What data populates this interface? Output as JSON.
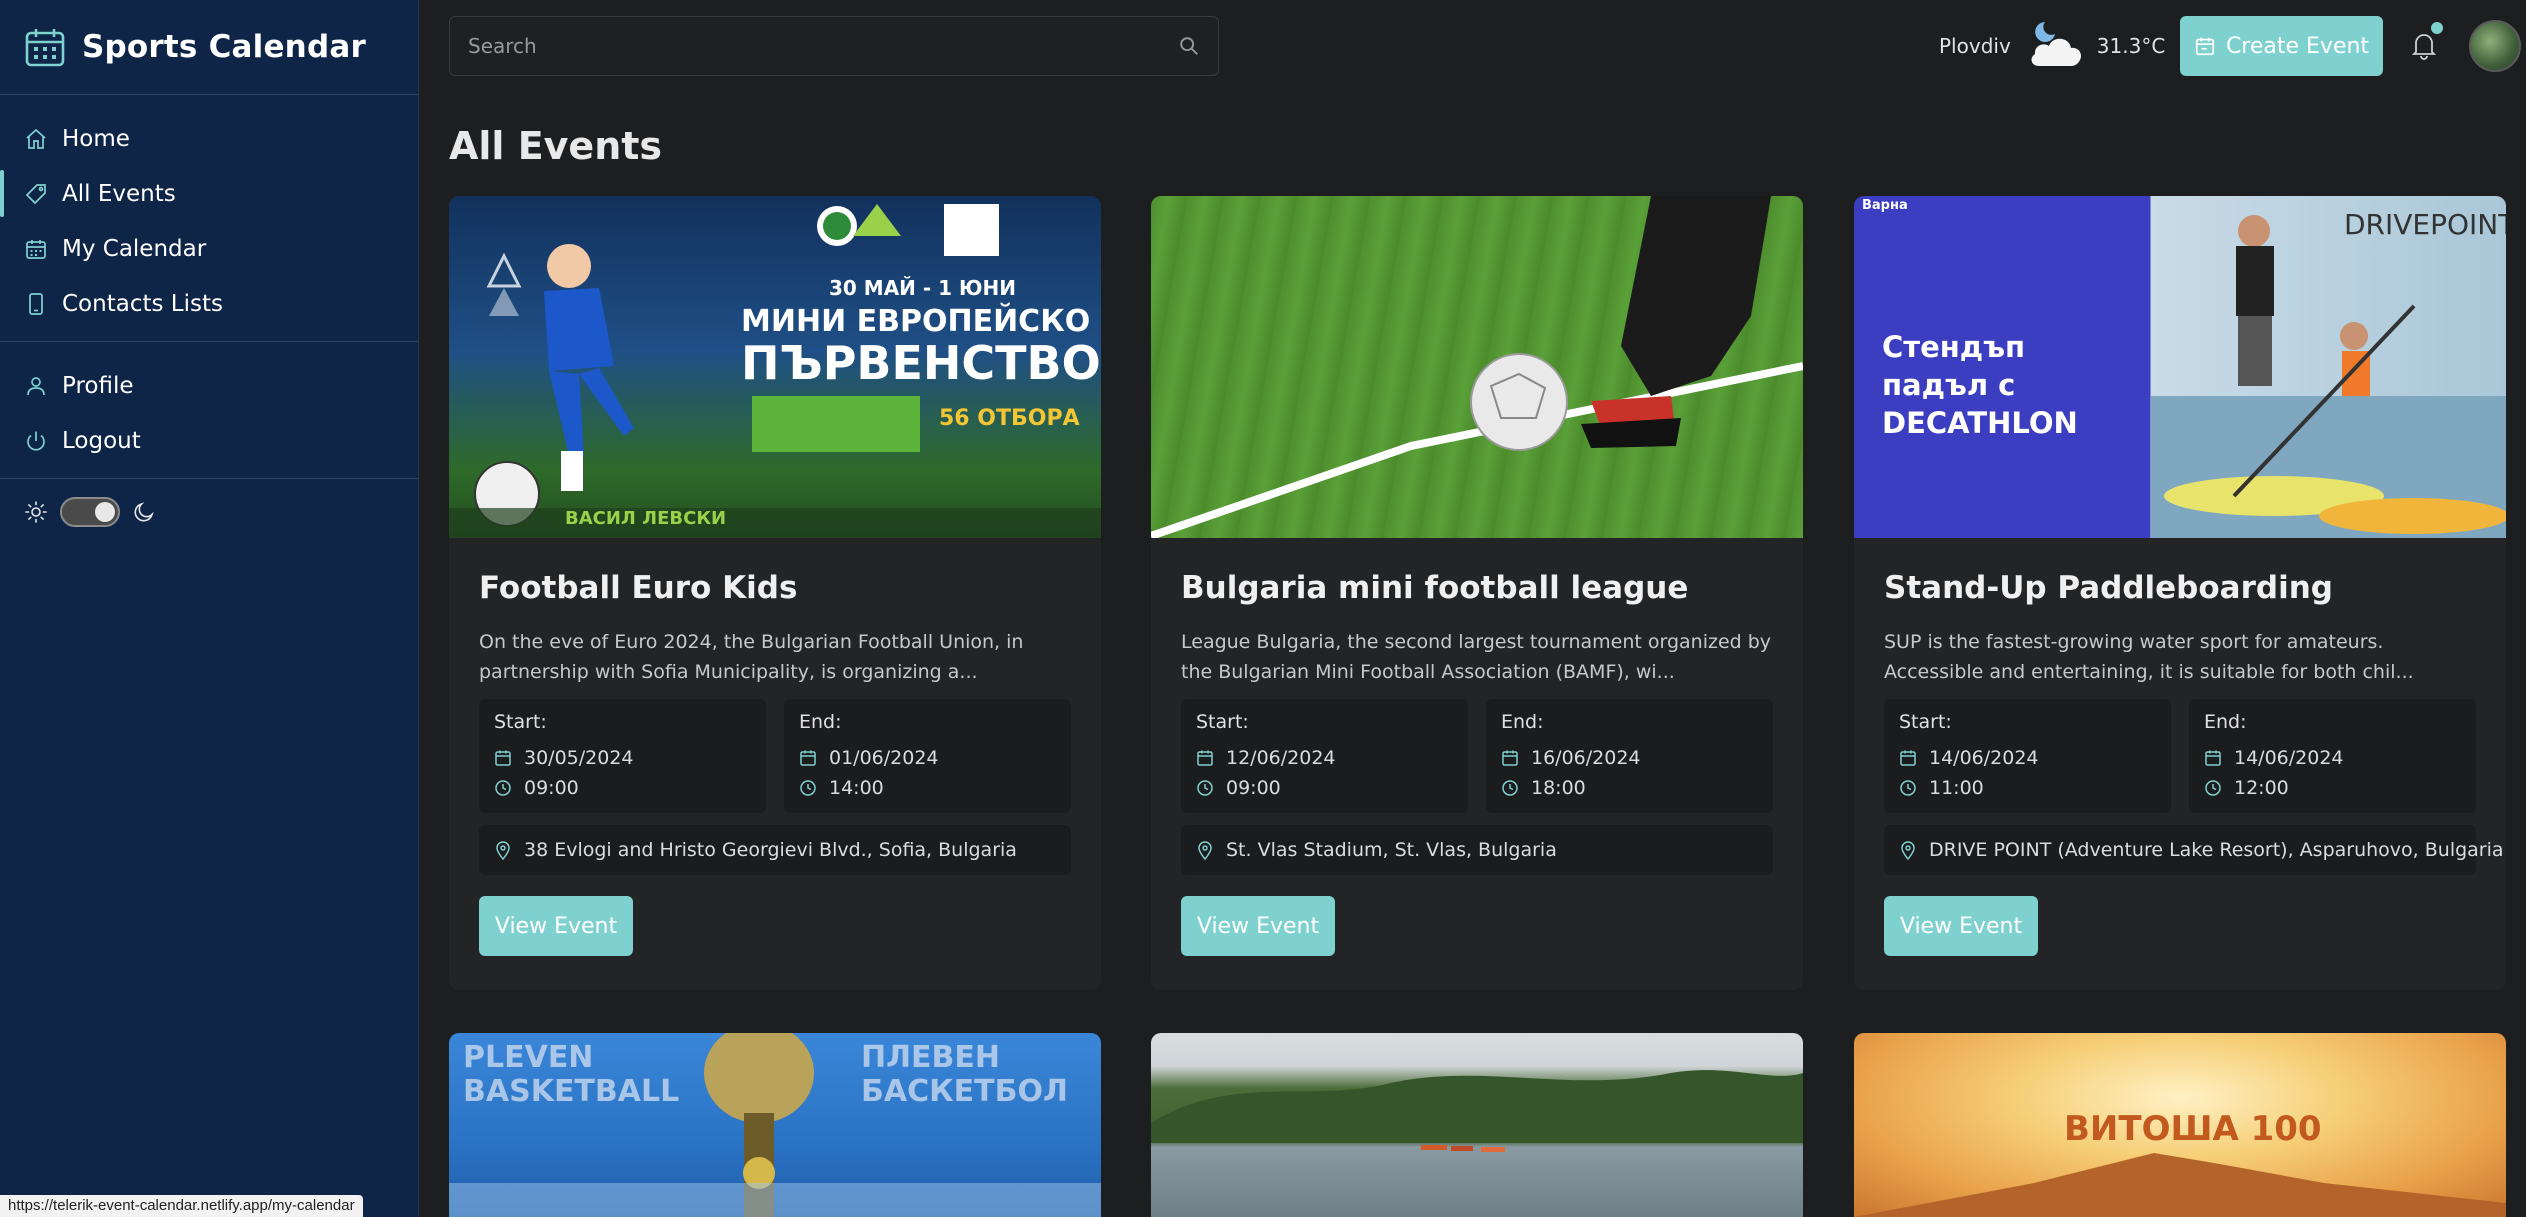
{
  "app": {
    "title": "Sports Calendar"
  },
  "sidebar": {
    "items": [
      {
        "label": "Home",
        "icon": "home-icon"
      },
      {
        "label": "All Events",
        "icon": "tag-icon",
        "active": true
      },
      {
        "label": "My Calendar",
        "icon": "calendar-icon"
      },
      {
        "label": "Contacts Lists",
        "icon": "phone-icon"
      }
    ],
    "account": [
      {
        "label": "Profile",
        "icon": "user-icon"
      },
      {
        "label": "Logout",
        "icon": "power-icon"
      }
    ],
    "theme_toggle": {
      "state": "dark"
    }
  },
  "search": {
    "placeholder": "Search"
  },
  "weather": {
    "city": "Plovdiv",
    "temperature": "31.3°C",
    "icon": "night-cloud-icon"
  },
  "header": {
    "create_label": "Create Event"
  },
  "main": {
    "title": "All Events"
  },
  "events": [
    {
      "title": "Football Euro Kids",
      "description": "On the eve of Euro 2024, the Bulgarian Football Union, in partnership with Sofia Municipality, is organizing a...",
      "start_label": "Start:",
      "start_date": "30/05/2024",
      "start_time": "09:00",
      "end_label": "End:",
      "end_date": "01/06/2024",
      "end_time": "14:00",
      "location": "38 Evlogi and Hristo Georgievi Blvd., Sofia, Bulgaria",
      "button": "View Event",
      "image_text": {
        "dates": "30 МАЙ - 1 ЮНИ",
        "line1": "МИНИ ЕВРОПЕЙСКО",
        "line2": "ПЪРВЕНСТВО",
        "badge": "56 ОТБОРА",
        "venue": "ВАСИЛ ЛЕВСКИ"
      }
    },
    {
      "title": "Bulgaria mini football league",
      "description": "League Bulgaria, the second largest tournament organized by the Bulgarian Mini Football Association (BAMF), wi...",
      "start_label": "Start:",
      "start_date": "12/06/2024",
      "start_time": "09:00",
      "end_label": "End:",
      "end_date": "16/06/2024",
      "end_time": "18:00",
      "location": "St. Vlas Stadium, St. Vlas, Bulgaria",
      "button": "View Event"
    },
    {
      "title": "Stand-Up Paddleboarding",
      "description": "SUP is the fastest-growing water sport for amateurs. Accessible and entertaining, it is suitable for both chil...",
      "start_label": "Start:",
      "start_date": "14/06/2024",
      "start_time": "11:00",
      "end_label": "End:",
      "end_date": "14/06/2024",
      "end_time": "12:00",
      "location": "DRIVE POINT (Adventure Lake Resort), Asparuhovo, Bulgaria",
      "button": "View Event",
      "image_text": {
        "corner": "Варна",
        "headline": "Стендъп падъл с DECATHLON",
        "brand": "DRIVEPOINT"
      }
    },
    {
      "image_text": {
        "left": "PLEVEN BASKETBALL",
        "right": "ПЛЕВЕН БАСКЕТБОЛ"
      }
    },
    {},
    {
      "image_text": {
        "title": "ВИТОША 100"
      }
    }
  ],
  "status_bar": {
    "url": "https://telerik-event-calendar.netlify.app/my-calendar"
  },
  "colors": {
    "accent": "#7fd1d0",
    "sidebar_bg": "#0e2547",
    "page_bg": "#1d1e20",
    "card_bg": "#232426"
  }
}
